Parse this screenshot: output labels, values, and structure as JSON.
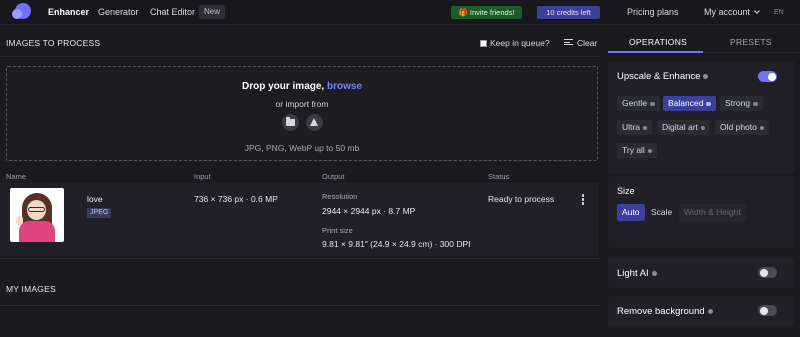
{
  "topbar": {
    "nav": [
      "Enhancer",
      "Generator",
      "Chat Editor"
    ],
    "new_badge": "New",
    "invite": "🎁 Invite friends!",
    "credits": "10 credits left",
    "pricing": "Pricing plans",
    "account": "My account",
    "lang": "EN"
  },
  "left": {
    "section_title": "IMAGES TO PROCESS",
    "keep_in_queue": "Keep in queue?",
    "clear": "Clear",
    "drop": {
      "title": "Drop your image,",
      "browse": "browse",
      "import_from": "or import from",
      "formats": "JPG, PNG, WebP up to 50 mb"
    },
    "columns": [
      "Name",
      "Input",
      "Output",
      "Status"
    ],
    "file": {
      "name": "love",
      "format": "JPEG",
      "input": "736 × 736 px · 0.6 MP",
      "resolution_label": "Resolution",
      "resolution": "2944 × 2944 px · 8.7 MP",
      "print_label": "Print size",
      "print": "9.81 × 9.81\" (24.9 × 24.9 cm) · 300 DPI",
      "status": "Ready to process"
    },
    "my_images": "MY IMAGES"
  },
  "right": {
    "tabs": [
      "OPERATIONS",
      "PRESETS"
    ],
    "active_tab": "OPERATIONS",
    "upscale": {
      "title": "Upscale & Enhance",
      "enabled": true,
      "modes": [
        "Gentle",
        "Balanced",
        "Strong",
        "Ultra",
        "Digital art",
        "Old photo",
        "Try all"
      ],
      "selected": "Balanced"
    },
    "size": {
      "title": "Size",
      "options": [
        "Auto",
        "Scale",
        "Width & Height"
      ],
      "selected": "Auto"
    },
    "light_ai": {
      "title": "Light AI",
      "enabled": false
    },
    "remove_bg": {
      "title": "Remove background",
      "enabled": false
    }
  },
  "colors": {
    "accent": "#6f72ff",
    "background": "#1a1a1f",
    "panel": "#202026",
    "invite_bg": "#1c5b2a",
    "credits_bg": "#3c3f9c"
  }
}
